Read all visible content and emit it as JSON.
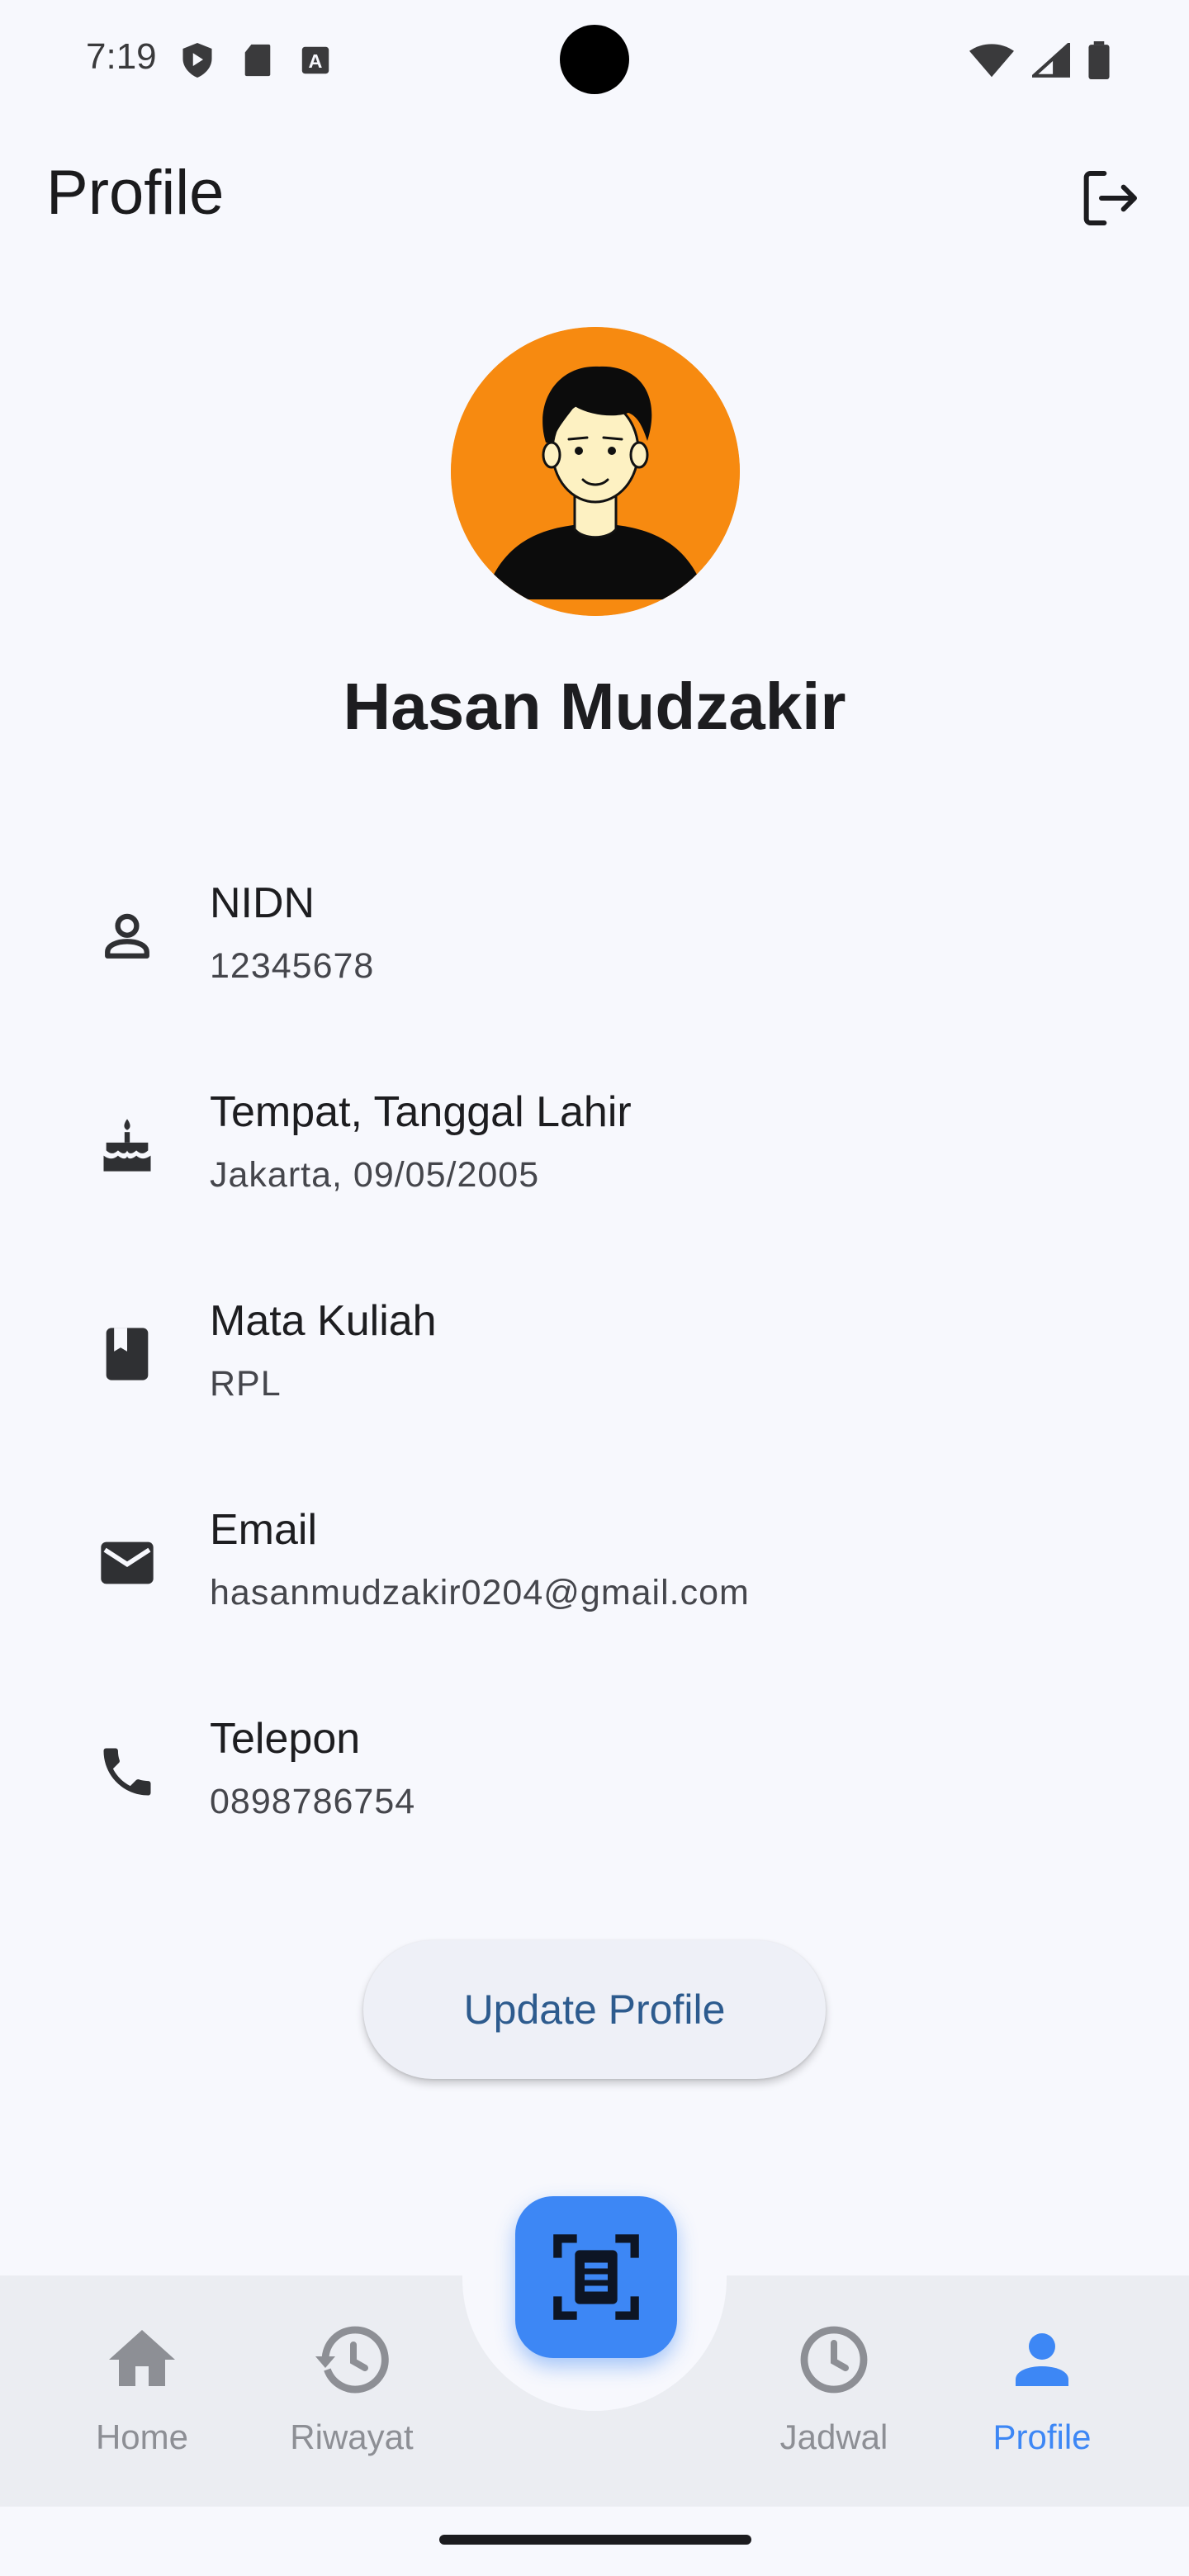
{
  "status_bar": {
    "time": "7:19"
  },
  "appbar": {
    "title": "Profile"
  },
  "profile": {
    "name": "Hasan Mudzakir"
  },
  "info": [
    {
      "label": "NIDN",
      "value": "12345678",
      "icon": "person-icon"
    },
    {
      "label": "Tempat, Tanggal Lahir",
      "value": "Jakarta, 09/05/2005",
      "icon": "cake-icon"
    },
    {
      "label": "Mata Kuliah",
      "value": "RPL",
      "icon": "book-icon"
    },
    {
      "label": "Email",
      "value": "hasanmudzakir0204@gmail.com",
      "icon": "email-icon"
    },
    {
      "label": "Telepon",
      "value": "0898786754",
      "icon": "phone-icon"
    }
  ],
  "actions": {
    "update_label": "Update Profile"
  },
  "nav": {
    "items": [
      {
        "label": "Home",
        "icon": "home-icon"
      },
      {
        "label": "Riwayat",
        "icon": "history-icon"
      },
      {
        "label": "Jadwal",
        "icon": "clock-icon"
      },
      {
        "label": "Profile",
        "icon": "person-icon",
        "active": true
      }
    ],
    "fab_icon": "scan-document-icon"
  },
  "colors": {
    "accent": "#3d87f5",
    "avatar_bg": "#f78a10",
    "button_text": "#2d5b8e",
    "background": "#f7f8fd",
    "nav_bg": "#ebedf2"
  }
}
